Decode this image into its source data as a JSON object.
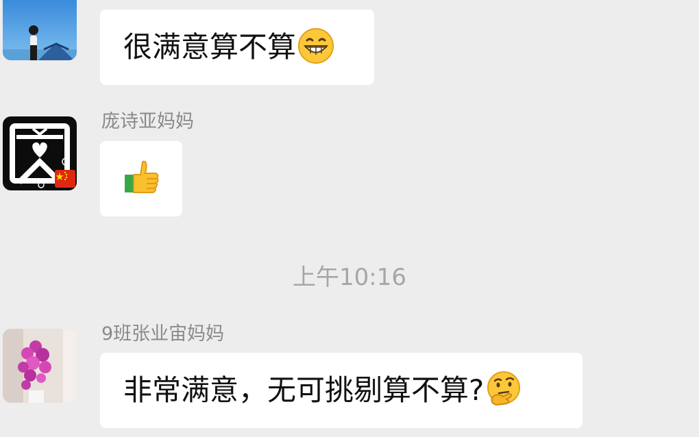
{
  "messages": [
    {
      "text": "很满意算不算",
      "emoji": "grinning-face"
    },
    {
      "name": "庞诗亚妈妈",
      "emoji": "thumbs-up",
      "flag": "china-flag"
    },
    {
      "name": "9班张业宙妈妈",
      "text": "非常满意，无可挑剔算不算?",
      "emoji": "thinking-face"
    }
  ],
  "timestamp": "上午10:16",
  "colors": {
    "background": "#ededed",
    "bubble": "#ffffff",
    "name_text": "#8a8a8a",
    "message_text": "#111111",
    "timestamp_text": "#a6a6a6"
  }
}
